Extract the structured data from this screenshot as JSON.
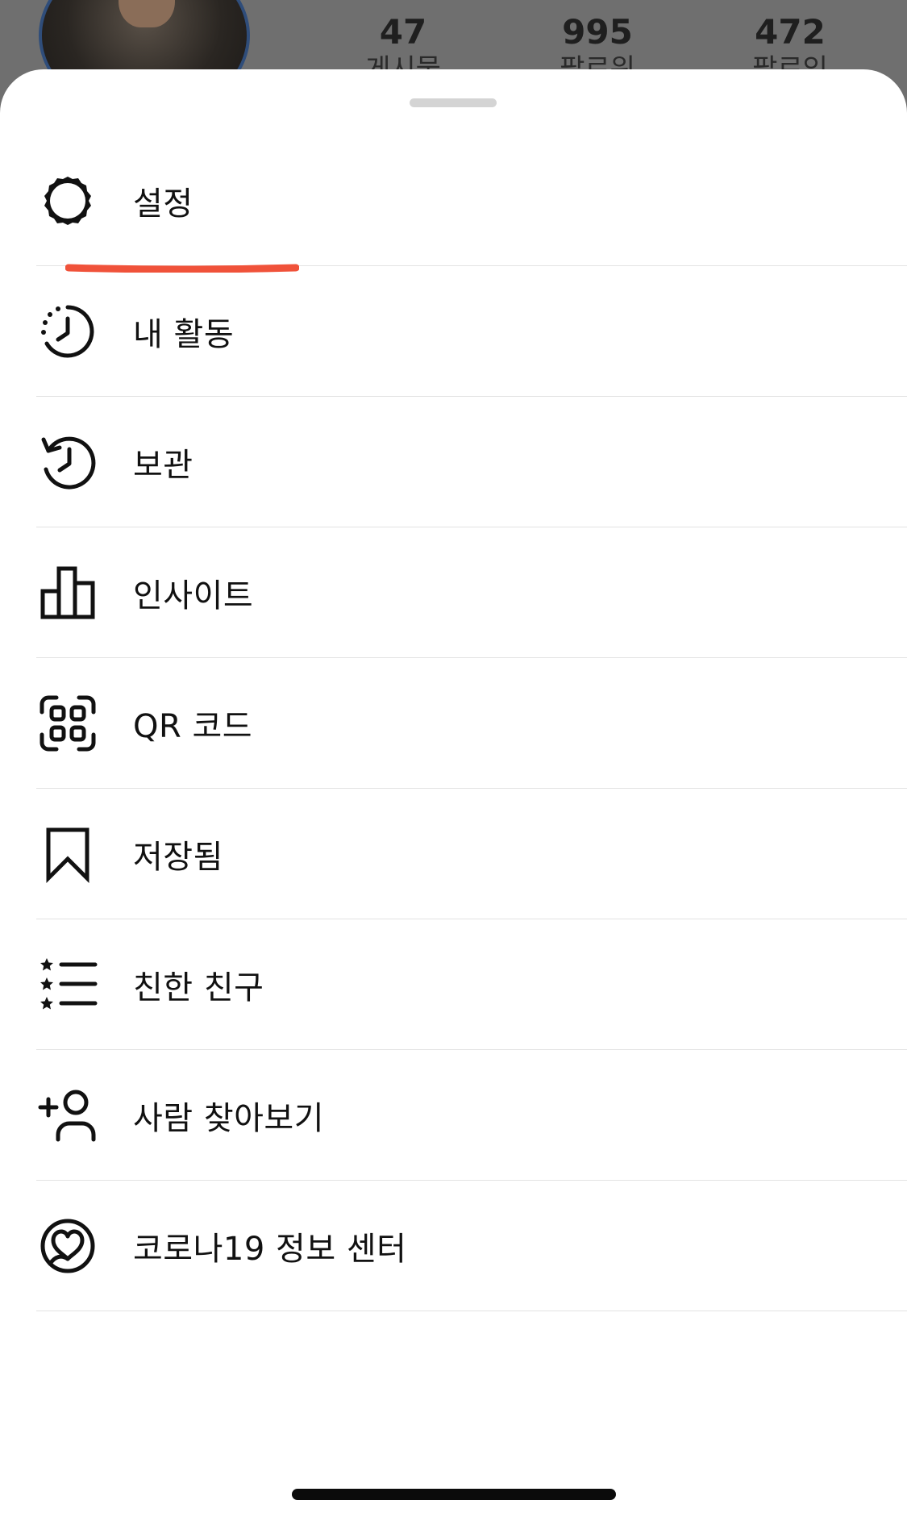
{
  "profile": {
    "stats": [
      {
        "value": "47",
        "label": "게시물"
      },
      {
        "value": "995",
        "label": "팔로워"
      },
      {
        "value": "472",
        "label": "팔로잉"
      }
    ]
  },
  "menu": {
    "items": [
      {
        "label": "설정",
        "icon": "settings-gear-icon"
      },
      {
        "label": "내 활동",
        "icon": "activity-clock-icon"
      },
      {
        "label": "보관",
        "icon": "archive-history-icon"
      },
      {
        "label": "인사이트",
        "icon": "insights-bar-chart-icon"
      },
      {
        "label": "QR 코드",
        "icon": "qr-code-scan-icon"
      },
      {
        "label": "저장됨",
        "icon": "bookmark-icon"
      },
      {
        "label": "친한 친구",
        "icon": "close-friends-star-list-icon"
      },
      {
        "label": "사람 찾아보기",
        "icon": "add-person-icon"
      },
      {
        "label": "코로나19 정보 센터",
        "icon": "covid-heart-icon"
      }
    ]
  },
  "colors": {
    "highlight": "#f0523a",
    "divider": "#e3e3e3",
    "text": "#111111"
  }
}
